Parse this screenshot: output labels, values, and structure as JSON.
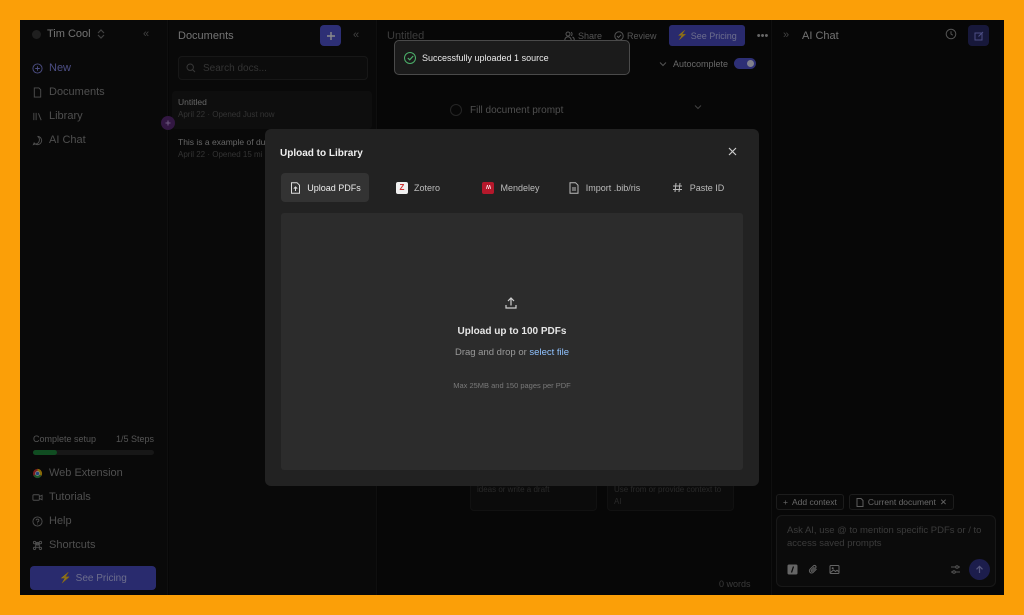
{
  "sidebar": {
    "user_name": "Tim Cool",
    "nav": [
      {
        "label": "New",
        "icon": "plus-circle-icon"
      },
      {
        "label": "Documents",
        "icon": "document-icon"
      },
      {
        "label": "Library",
        "icon": "library-icon"
      },
      {
        "label": "AI Chat",
        "icon": "chat-bubble-icon"
      }
    ],
    "setup": {
      "label": "Complete setup",
      "steps": "1/5 Steps",
      "progress": 0.2
    },
    "bottom_nav": [
      {
        "label": "Web Extension",
        "icon": "chrome-icon"
      },
      {
        "label": "Tutorials",
        "icon": "video-icon"
      },
      {
        "label": "Help",
        "icon": "help-icon"
      },
      {
        "label": "Shortcuts",
        "icon": "command-icon"
      }
    ],
    "pricing_label": "See Pricing"
  },
  "documents": {
    "title": "Documents",
    "search_placeholder": "Search docs...",
    "items": [
      {
        "title": "Untitled",
        "meta": "April 22 · Opened Just now"
      },
      {
        "title": "This is a example of du",
        "meta": "April 22 · Opened 15 mi"
      }
    ]
  },
  "editor": {
    "title": "Untitled",
    "share_label": "Share",
    "review_label": "Review",
    "pricing_label": "See Pricing",
    "autocomplete_label": "Autocomplete",
    "autocomplete_on": true,
    "fill_prompt_label": "Fill document prompt",
    "card_left_text": "ideas or write a draft",
    "card_right_text": "Use from or provide context to AI",
    "word_count": "0 words"
  },
  "toast": {
    "message": "Successfully uploaded 1 source"
  },
  "chat": {
    "title": "AI Chat",
    "add_context_label": "Add context",
    "current_doc_label": "Current document",
    "input_placeholder": "Ask AI, use @ to mention specific PDFs or / to access saved prompts"
  },
  "modal": {
    "title": "Upload to Library",
    "tabs": [
      {
        "label": "Upload PDFs",
        "icon": "upload-pdf-icon",
        "active": true
      },
      {
        "label": "Zotero",
        "icon": "zotero-icon",
        "active": false
      },
      {
        "label": "Mendeley",
        "icon": "mendeley-icon",
        "active": false
      },
      {
        "label": "Import .bib/ris",
        "icon": "file-import-icon",
        "active": false
      },
      {
        "label": "Paste ID",
        "icon": "hash-icon",
        "active": false
      }
    ],
    "drop_title": "Upload up to 100 PDFs",
    "drop_sub_prefix": "Drag and drop or ",
    "drop_link": "select file",
    "drop_note": "Max 25MB and 150 pages per PDF"
  },
  "colors": {
    "accent": "#5356d6",
    "background_frame": "#fb9f08",
    "success": "#4caf6a",
    "link": "#8fc2ff"
  }
}
